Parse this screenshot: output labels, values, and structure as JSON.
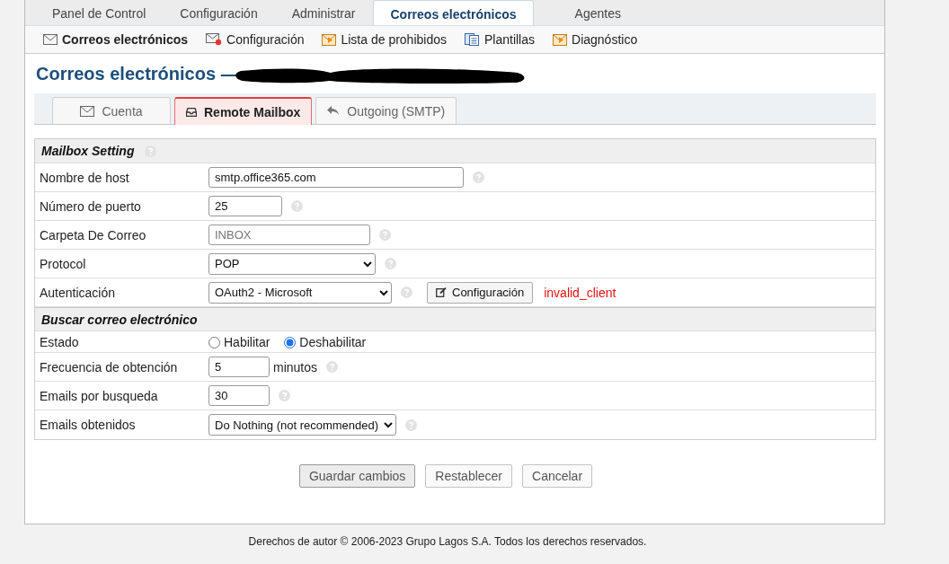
{
  "top_tabs": [
    {
      "label": "Panel de Control",
      "selected": false
    },
    {
      "label": "Configuración",
      "selected": false
    },
    {
      "label": "Administrar",
      "selected": false
    },
    {
      "label": "Correos electrónicos",
      "selected": true
    },
    {
      "label": "Agentes",
      "selected": false
    }
  ],
  "sub_nav": [
    {
      "label": "Correos electrónicos",
      "kind": "envelope",
      "selected": true
    },
    {
      "label": "Configuración",
      "kind": "envelope-gear",
      "selected": false
    },
    {
      "label": "Lista de prohibidos",
      "kind": "envelope-arrow",
      "selected": false
    },
    {
      "label": "Plantillas",
      "kind": "documents",
      "selected": false
    },
    {
      "label": "Diagnóstico",
      "kind": "envelope-arrow",
      "selected": false
    }
  ],
  "page_title": "Correos electrónicos —",
  "tabs": [
    {
      "label": "Cuenta",
      "kind": "envelope",
      "selected": false
    },
    {
      "label": "Remote Mailbox",
      "kind": "inbox",
      "selected": true
    },
    {
      "label": "Outgoing (SMTP)",
      "kind": "reply",
      "selected": false
    }
  ],
  "sections": [
    {
      "title": "Mailbox Setting",
      "help": true,
      "rows": [
        {
          "label": "Nombre de host",
          "kind": "text",
          "value": "smtp.office365.com",
          "help": true
        },
        {
          "label": "Número de puerto",
          "kind": "text",
          "value": "25",
          "help": true
        },
        {
          "label": "Carpeta De Correo",
          "kind": "text",
          "placeholder": "INBOX",
          "help": true
        },
        {
          "label": "Protocol",
          "kind": "select",
          "value": "POP",
          "help": true
        },
        {
          "label": "Autenticación",
          "kind": "select",
          "value": "OAuth2 - Microsoft",
          "help": true,
          "button": "Configuración",
          "error": "invalid_client"
        }
      ]
    },
    {
      "title": "Buscar correo electrónico",
      "help": false,
      "rows": [
        {
          "label": "Estado",
          "kind": "radio",
          "options": [
            {
              "label": "Habilitar",
              "selected": false
            },
            {
              "label": "Deshabilitar",
              "selected": true
            }
          ]
        },
        {
          "label": "Frecuencia de obtención",
          "kind": "text",
          "value": "5",
          "suffix": "minutos",
          "help": true
        },
        {
          "label": "Emails por busqueda",
          "kind": "text",
          "value": "30",
          "help": true
        },
        {
          "label": "Emails obtenidos",
          "kind": "select",
          "value": "Do Nothing (not recommended)",
          "help": true
        }
      ]
    }
  ],
  "buttons": [
    {
      "label": "Guardar cambios",
      "default": true
    },
    {
      "label": "Restablecer",
      "default": false
    },
    {
      "label": "Cancelar",
      "default": false
    }
  ],
  "footer": "Derechos de autor © 2006-2023 Grupo Lagos S.A. Todos los derechos reservados."
}
